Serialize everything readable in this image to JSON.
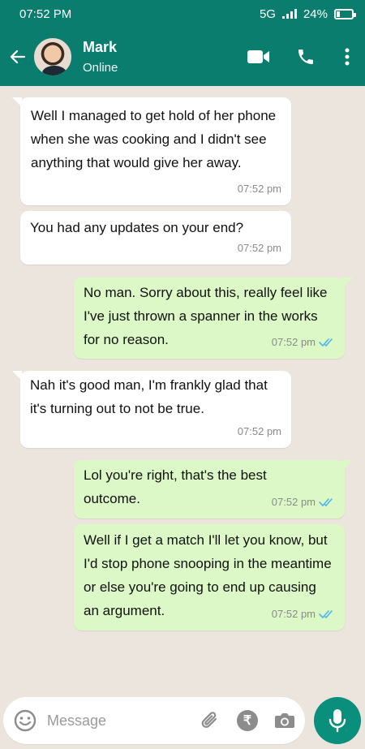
{
  "status_bar": {
    "time": "07:52 PM",
    "network": "5G",
    "battery": "24%"
  },
  "header": {
    "contact_name": "Mark",
    "contact_status": "Online",
    "icons": [
      "back-arrow-icon",
      "video-call-icon",
      "voice-call-icon",
      "more-options-icon"
    ]
  },
  "messages": [
    {
      "direction": "in",
      "text": "Well I managed to get hold of her phone when she was cooking and I didn't see anything that would give her away.",
      "time": "07:52 pm"
    },
    {
      "direction": "in",
      "text": "You had any updates on your end?",
      "time": "07:52 pm"
    },
    {
      "direction": "out",
      "text": "No man. Sorry about this, really feel like I've just thrown a spanner in the works for no reason.",
      "time": "07:52 pm"
    },
    {
      "direction": "in",
      "text": "Nah it's good man, I'm frankly glad that it's turning out to not be true.",
      "time": "07:52 pm"
    },
    {
      "direction": "out",
      "text": "Lol you're right, that's the best outcome.",
      "time": "07:52 pm"
    },
    {
      "direction": "out",
      "text": "Well if I get a match I'll let you know, but I'd stop phone snooping in the meantime or else you're going to end up causing an argument.",
      "time": "07:52 pm"
    }
  ],
  "composer": {
    "placeholder": "Message",
    "value": ""
  },
  "colors": {
    "header": "#0A7D6E",
    "chat_bg": "#ECE5DD",
    "bubble_out": "#DCF8C6",
    "bubble_in": "#FFFFFF",
    "read_ticks": "#4FB6EC",
    "mic_button": "#0A8F7C"
  }
}
